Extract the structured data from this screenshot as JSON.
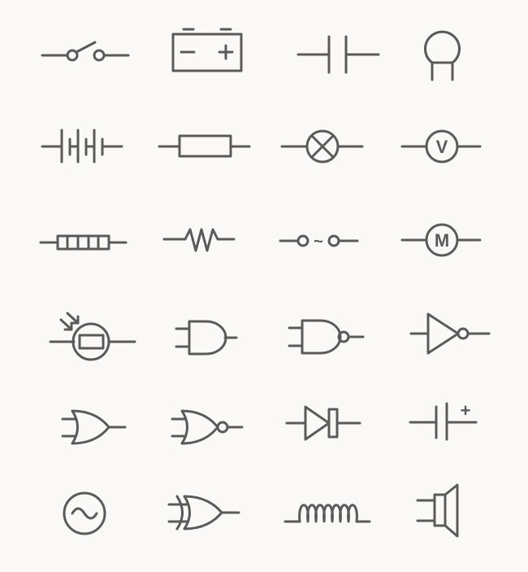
{
  "diagram": {
    "background": "#faf9f8",
    "stroke_color": "#5a5a58",
    "symbols": [
      {
        "id": "switch-open",
        "icon": "switch-icon"
      },
      {
        "id": "battery-box",
        "icon": "battery-icon",
        "labels": {
          "minus": "−",
          "plus": "+"
        }
      },
      {
        "id": "capacitor",
        "icon": "capacitor-icon"
      },
      {
        "id": "thermistor",
        "icon": "thermistor-icon"
      },
      {
        "id": "battery-multi",
        "icon": "multi-cell-battery-icon"
      },
      {
        "id": "resistor-box",
        "icon": "resistor-icon"
      },
      {
        "id": "lamp",
        "icon": "lamp-icon"
      },
      {
        "id": "voltmeter",
        "icon": "voltmeter-icon",
        "labels": {
          "letter": "V"
        }
      },
      {
        "id": "heater",
        "icon": "heater-icon"
      },
      {
        "id": "resistor-zigzag",
        "icon": "zigzag-resistor-icon"
      },
      {
        "id": "ac-supply",
        "icon": "ac-supply-icon",
        "labels": {
          "tilde": "~"
        }
      },
      {
        "id": "motor",
        "icon": "motor-icon",
        "labels": {
          "letter": "M"
        }
      },
      {
        "id": "ldr",
        "icon": "ldr-icon"
      },
      {
        "id": "and-gate",
        "icon": "and-gate-icon"
      },
      {
        "id": "nand-gate",
        "icon": "nand-gate-icon"
      },
      {
        "id": "not-gate",
        "icon": "not-gate-icon"
      },
      {
        "id": "or-gate",
        "icon": "or-gate-icon"
      },
      {
        "id": "nor-gate",
        "icon": "nor-gate-icon"
      },
      {
        "id": "diode",
        "icon": "diode-icon"
      },
      {
        "id": "polarized-capacitor",
        "icon": "polarized-capacitor-icon",
        "labels": {
          "plus": "+"
        }
      },
      {
        "id": "ac-source",
        "icon": "ac-source-icon"
      },
      {
        "id": "xor-gate",
        "icon": "xor-gate-icon"
      },
      {
        "id": "inductor",
        "icon": "inductor-icon"
      },
      {
        "id": "speaker",
        "icon": "speaker-icon"
      }
    ]
  }
}
